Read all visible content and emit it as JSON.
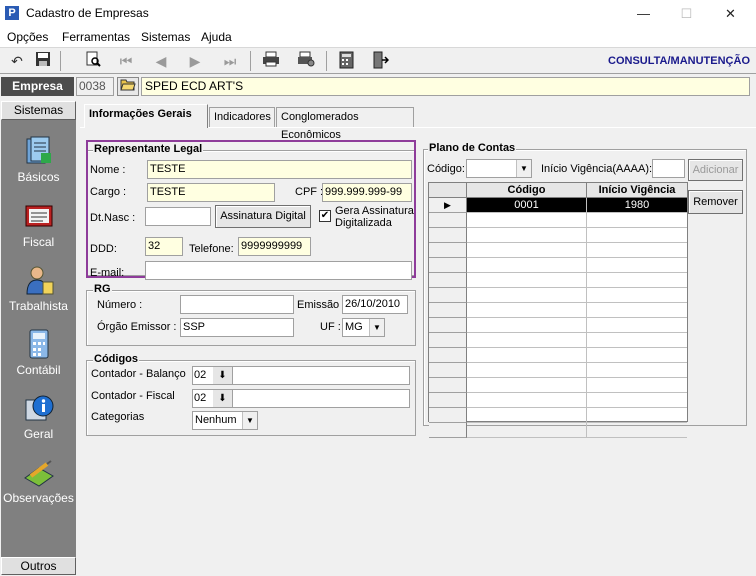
{
  "window": {
    "title": "Cadastro de Empresas",
    "icon_letter": "P",
    "controls": [
      "—",
      "☐",
      "✕"
    ]
  },
  "menu": [
    {
      "label": "Opções"
    },
    {
      "label": "Ferramentas"
    },
    {
      "label": "Sistemas"
    },
    {
      "label": "Ajuda"
    }
  ],
  "toolbar": {
    "mode_label": "CONSULTA/MANUTENÇÃO",
    "buttons": [
      {
        "icon": "undo-icon",
        "glyph": "↶"
      },
      {
        "icon": "save-icon",
        "glyph": "💾"
      },
      {
        "icon": "preview-icon",
        "glyph": "🔍"
      },
      {
        "icon": "first-record-icon",
        "glyph": "⏮"
      },
      {
        "icon": "previous-record-icon",
        "glyph": "◀"
      },
      {
        "icon": "next-record-icon",
        "glyph": "▶"
      },
      {
        "icon": "last-record-icon",
        "glyph": "⏭"
      },
      {
        "icon": "print-icon",
        "glyph": "🖶"
      },
      {
        "icon": "print-setup-icon",
        "glyph": "⎙"
      },
      {
        "icon": "calculator-icon",
        "glyph": "▦"
      },
      {
        "icon": "exit-icon",
        "glyph": "⇥"
      }
    ]
  },
  "empresa": {
    "label": "Empresa",
    "code": "0038",
    "name": "SPED ECD ART'S"
  },
  "sidebar": {
    "top_label": "Sistemas",
    "bottom_label": "Outros",
    "items": [
      {
        "label": "Básicos",
        "icon": "basicos-icon"
      },
      {
        "label": "Fiscal",
        "icon": "fiscal-icon"
      },
      {
        "label": "Trabalhista",
        "icon": "trabalhista-icon"
      },
      {
        "label": "Contábil",
        "icon": "contabil-icon"
      },
      {
        "label": "Geral",
        "icon": "geral-icon"
      },
      {
        "label": "Observações",
        "icon": "observacoes-icon"
      }
    ]
  },
  "tabs": [
    {
      "label": "Informações Gerais",
      "active": true
    },
    {
      "label": "Indicadores",
      "active": false
    },
    {
      "label": "Conglomerados Econômicos",
      "active": false
    }
  ],
  "representante": {
    "title": "Representante Legal",
    "nome_label": "Nome :",
    "nome_value": "TESTE",
    "cargo_label": "Cargo :",
    "cargo_value": "TESTE",
    "cpf_label": "CPF :",
    "cpf_value": "999.999.999-99",
    "dtnasc_label": "Dt.Nasc :",
    "dtnasc_value": "",
    "assinatura_button": "Assinatura Digital",
    "gera_assinatura_label_1": "Gera Assinatura",
    "gera_assinatura_label_2": "Digitalizada",
    "gera_assinatura_checked": "✔",
    "ddd_label": "DDD:",
    "ddd_value": "32",
    "telefone_label": "Telefone:",
    "telefone_value": "9999999999",
    "email_label": "E-mail:",
    "email_value": ""
  },
  "rg": {
    "title": "RG",
    "numero_label": "Número :",
    "numero_value": "",
    "emissao_label": "Emissão :",
    "emissao_value": "26/10/2010",
    "orgao_label": "Órgão Emissor :",
    "orgao_value": "SSP",
    "uf_label": "UF :",
    "uf_value": "MG"
  },
  "codigos": {
    "title": "Códigos",
    "contador_balanco_label": "Contador - Balanço",
    "contador_balanco_value": "02",
    "contador_fiscal_label": "Contador - Fiscal",
    "contador_fiscal_value": "02",
    "categorias_label": "Categorias",
    "categorias_value": "Nenhum"
  },
  "plano": {
    "title": "Plano de Contas",
    "codigo_label": "Código:",
    "codigo_value": "",
    "inicio_label": "Início Vigência(AAAA):",
    "inicio_value": "",
    "adicionar_button": "Adicionar",
    "remover_button": "Remover",
    "grid_headers": [
      "Código",
      "Início Vigência"
    ],
    "grid_rows": [
      {
        "codigo": "0001",
        "inicio": "1980",
        "selected": true,
        "indicator": "▶"
      }
    ],
    "empty_rows": 15
  }
}
